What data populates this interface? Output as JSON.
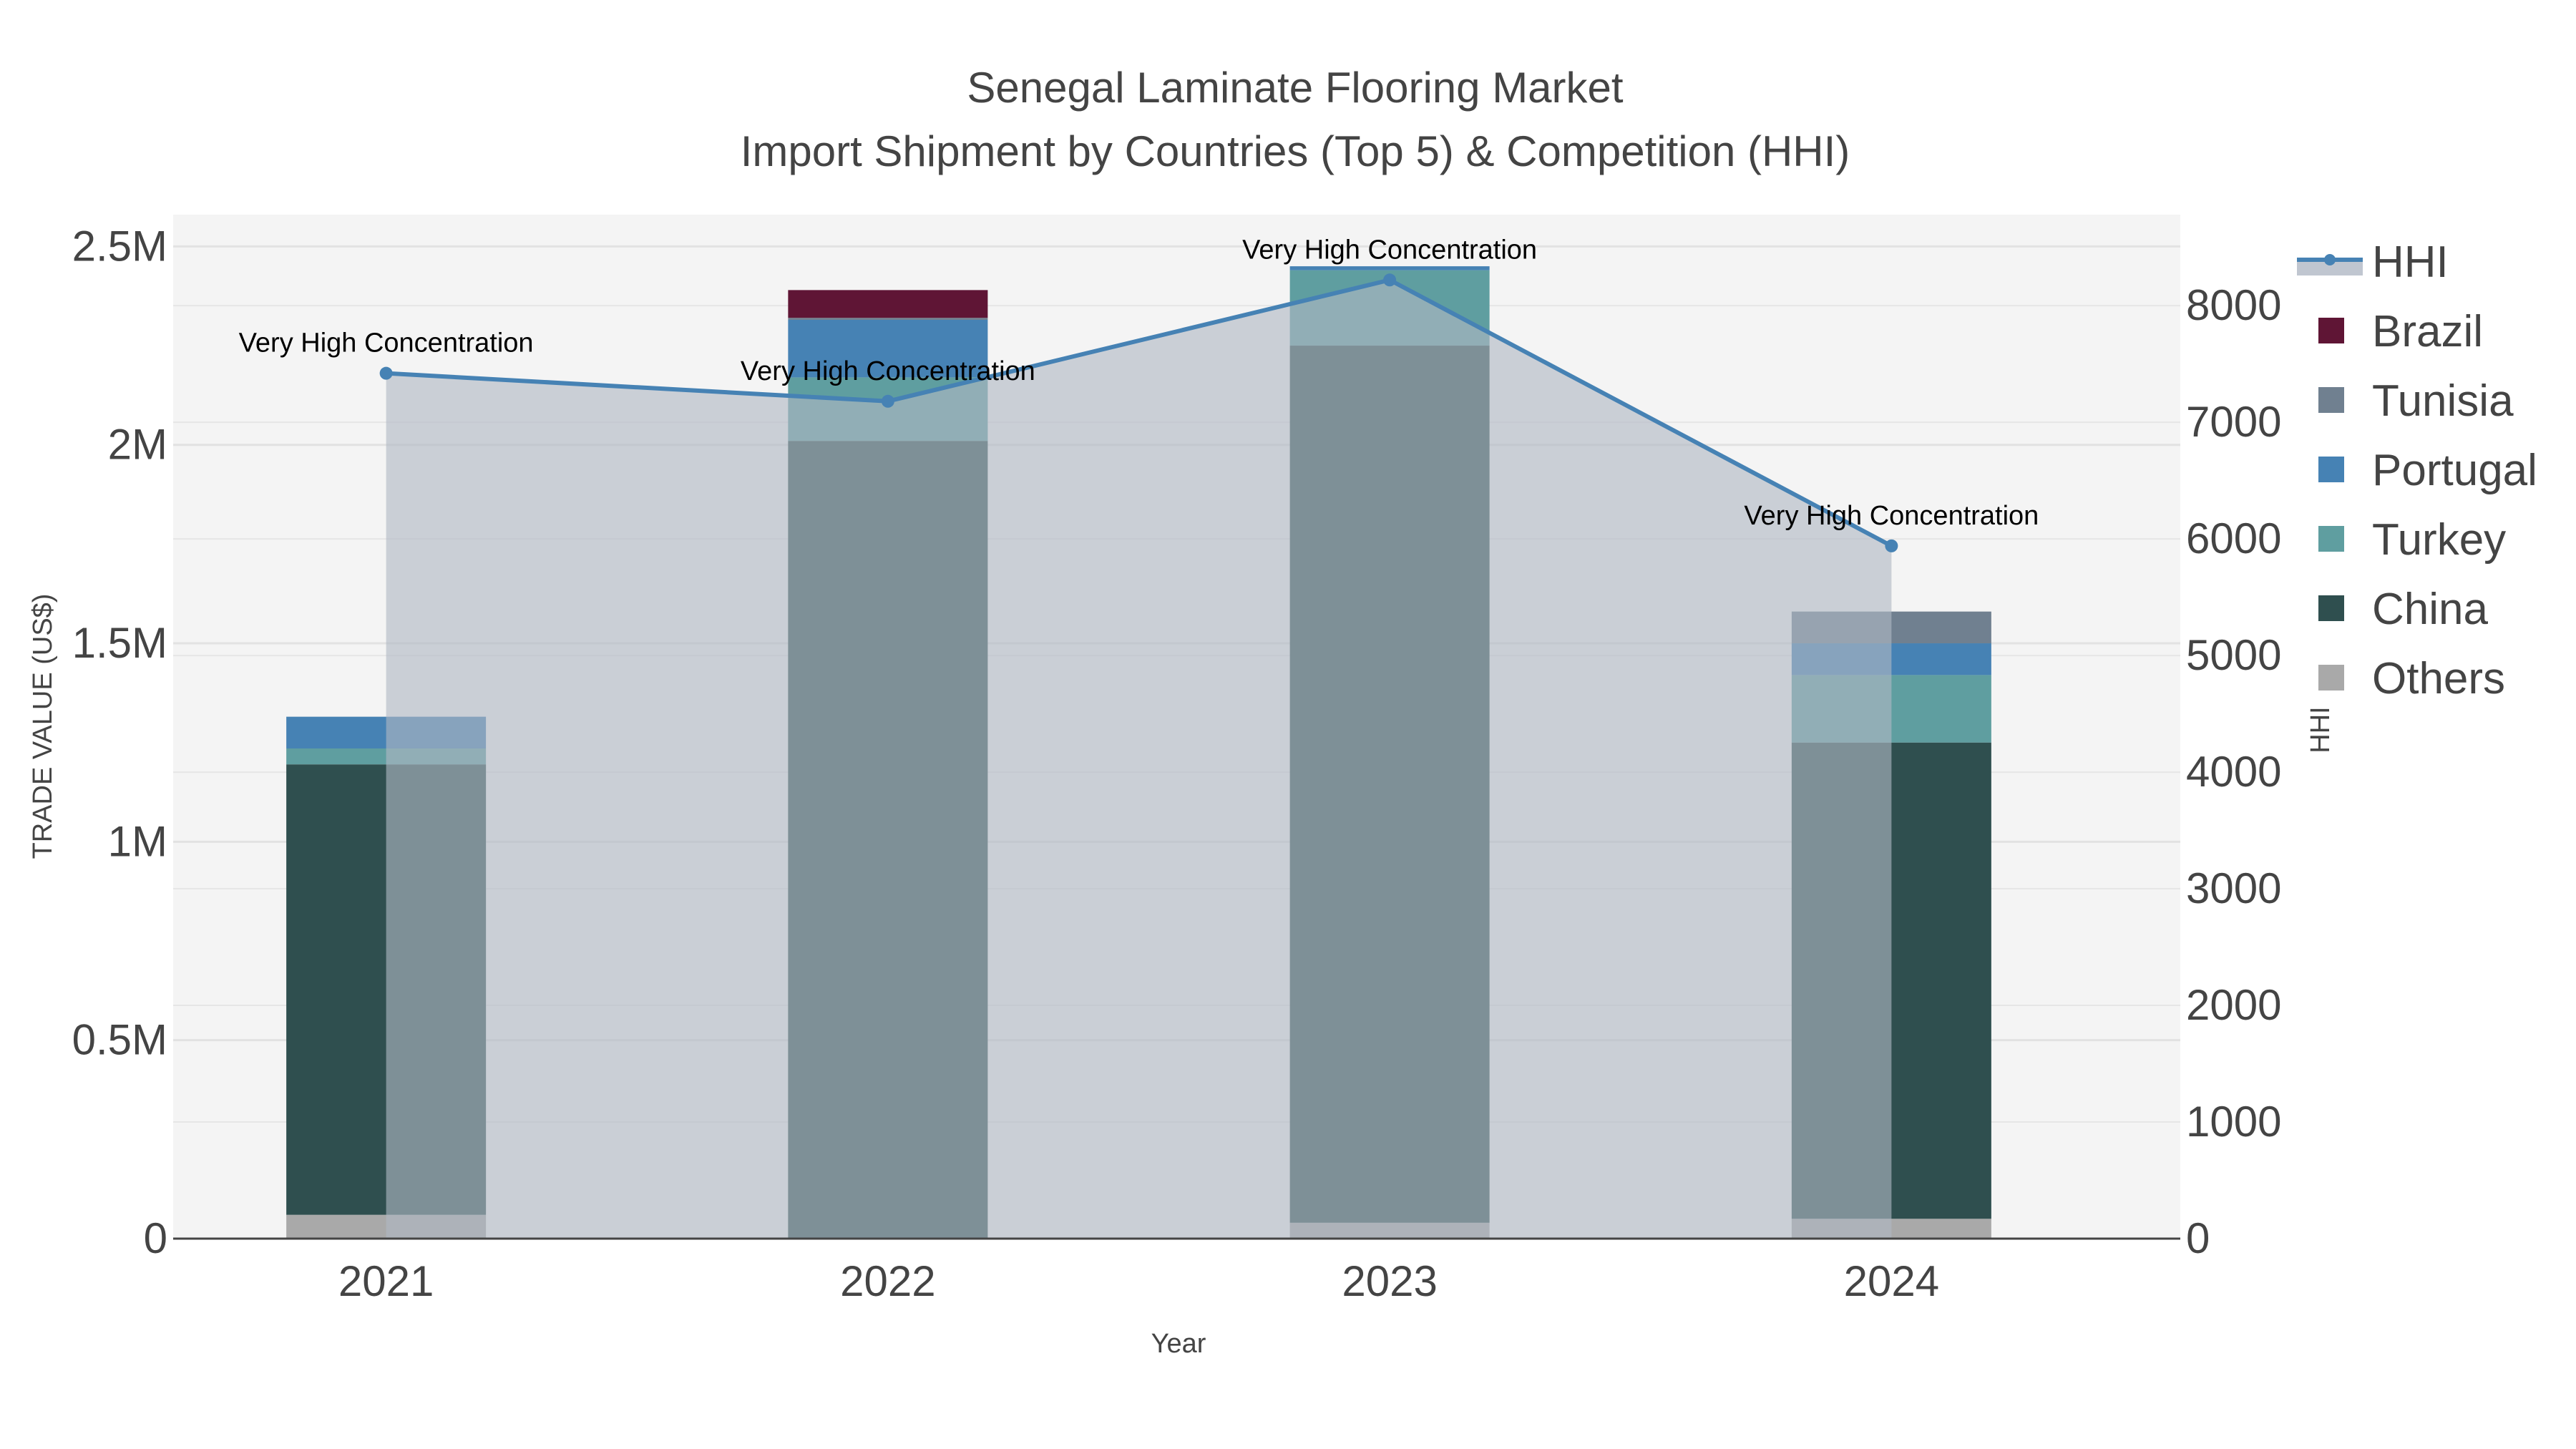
{
  "chart_data": {
    "type": "bar",
    "title": "Senegal Laminate Flooring Market",
    "subtitle": "Import Shipment by Countries (Top 5) & Competition (HHI)",
    "xlabel": "Year",
    "ylabel": "TRADE VALUE (US$)",
    "y2label": "HHI",
    "categories": [
      "2021",
      "2022",
      "2023",
      "2024"
    ],
    "ylim": [
      0,
      2580000
    ],
    "y2lim": [
      0,
      8780
    ],
    "yticks": [
      {
        "v": 0,
        "label": "0"
      },
      {
        "v": 500000,
        "label": "0.5M"
      },
      {
        "v": 1000000,
        "label": "1M"
      },
      {
        "v": 1500000,
        "label": "1.5M"
      },
      {
        "v": 2000000,
        "label": "2M"
      },
      {
        "v": 2500000,
        "label": "2.5M"
      }
    ],
    "y2ticks": [
      0,
      1000,
      2000,
      3000,
      4000,
      5000,
      6000,
      7000,
      8000
    ],
    "stacked": true,
    "series": [
      {
        "name": "Others",
        "color": "#a9a9a9",
        "values": [
          60000,
          0,
          40000,
          50000
        ]
      },
      {
        "name": "China",
        "color": "#2f4f4f",
        "values": [
          1135000,
          2010000,
          2210000,
          1200000
        ]
      },
      {
        "name": "Turkey",
        "color": "#5f9ea0",
        "values": [
          40000,
          160000,
          190000,
          170000
        ]
      },
      {
        "name": "Portugal",
        "color": "#4682b4",
        "values": [
          80000,
          145000,
          10000,
          80000
        ]
      },
      {
        "name": "Tunisia",
        "color": "#708090",
        "values": [
          0,
          5000,
          0,
          80000
        ]
      },
      {
        "name": "Brazil",
        "color": "#5f1535",
        "values": [
          0,
          70000,
          0,
          0
        ]
      }
    ],
    "hhi": {
      "name": "HHI",
      "color": "#4682b4",
      "values": [
        7420,
        7180,
        8220,
        5940
      ],
      "annotations": [
        "Very High Concentration",
        "Very High Concentration",
        "Very High Concentration",
        "Very High Concentration"
      ]
    },
    "legend": {
      "placement": "right",
      "order": [
        "HHI",
        "Brazil",
        "Tunisia",
        "Portugal",
        "Turkey",
        "China",
        "Others"
      ]
    },
    "grid": true
  }
}
